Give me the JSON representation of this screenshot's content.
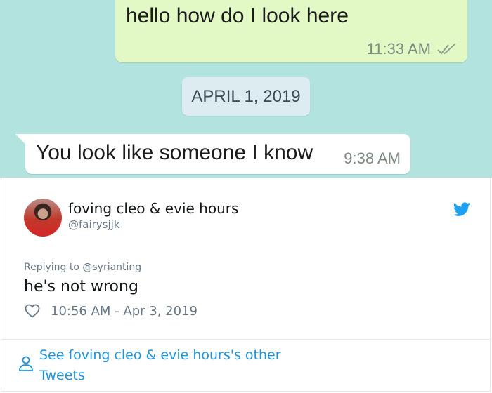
{
  "chat": {
    "outgoing": {
      "text": "hello how do I look here",
      "time": "11:33 AM",
      "status_icon": "double-check-icon"
    },
    "date_divider": "APRIL 1, 2019",
    "incoming": {
      "text": "You look like someone I know",
      "time": "9:38 AM"
    },
    "colors": {
      "background": "#b3e3de",
      "outgoing_bubble": "#e2f9c6",
      "date_pill": "#dcecf1"
    }
  },
  "tweet": {
    "display_name": "ſoving cleo & evie hours",
    "handle": "@fairysjjk",
    "replying_to": "Replying to @syrianting",
    "text": "he's not wrong",
    "timestamp": "10:56 AM - Apr 3, 2019",
    "see_more": "See ſoving cleo & evie hours's other Tweets",
    "icons": [
      "twitter-bird-icon",
      "heart-icon",
      "person-icon"
    ],
    "colors": {
      "brand": "#1da1f2",
      "link": "#1b95e0",
      "muted": "#657786"
    }
  }
}
